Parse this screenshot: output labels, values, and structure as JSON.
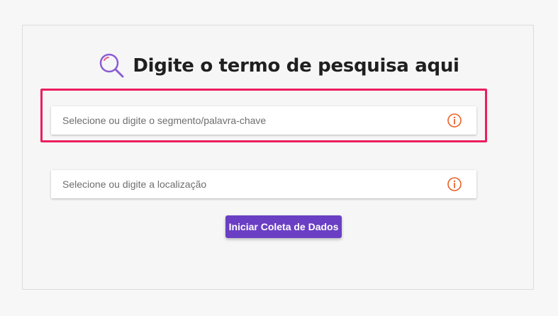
{
  "header": {
    "title": "Digite o termo de pesquisa aqui",
    "icon": "search-icon",
    "icon_color": "#8a5cd6"
  },
  "form": {
    "keyword_field": {
      "placeholder": "Selecione ou digite o segmento/palavra-chave",
      "value": "",
      "info_icon": "info-icon"
    },
    "location_field": {
      "placeholder": "Selecione ou digite a localização",
      "value": "",
      "info_icon": "info-icon"
    },
    "submit_label": "Iniciar Coleta de Dados"
  },
  "colors": {
    "accent": "#6a3fc4",
    "info_icon": "#e8622a",
    "highlight_border": "#ec1e5e"
  }
}
